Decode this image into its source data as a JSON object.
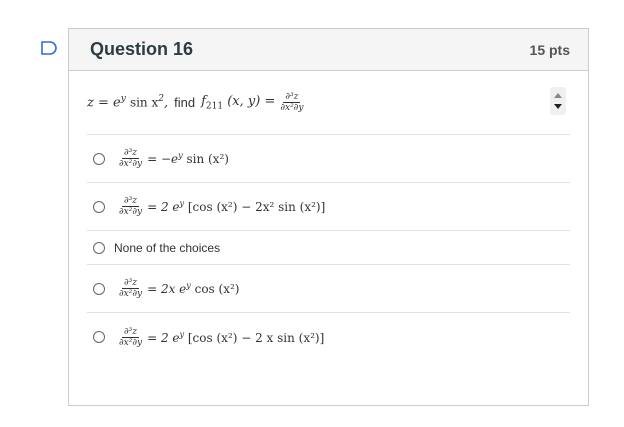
{
  "question": {
    "title": "Question 16",
    "points": "15 pts",
    "prompt_text": "find",
    "prompt_lhs": "z = e",
    "prompt_lhs_sup": "y",
    "prompt_sin": "sin x",
    "prompt_f": "f",
    "prompt_f_sub": "211",
    "prompt_args": "(x, y) =",
    "prompt_frac_num": "∂³z",
    "prompt_frac_den": "∂x²∂y"
  },
  "answers": [
    {
      "frac_num": "∂³z",
      "frac_den": "∂x²∂y",
      "rhs": "= −e",
      "rhs_sup": "y",
      "rhs_tail": " sin (x²)"
    },
    {
      "frac_num": "∂³z",
      "frac_den": "∂x²∂y",
      "rhs": "= 2 e",
      "rhs_sup": "y",
      "rhs_tail": " [cos (x²) − 2x² sin (x²)]"
    },
    {
      "text": "None of the choices"
    },
    {
      "frac_num": "∂³z",
      "frac_den": "∂x²∂y",
      "rhs": "= 2x e",
      "rhs_sup": "y",
      "rhs_tail": " cos (x²)"
    },
    {
      "frac_num": "∂³z",
      "frac_den": "∂x²∂y",
      "rhs": "= 2 e",
      "rhs_sup": "y",
      "rhs_tail": " [cos (x²) − 2 x sin (x²)]"
    }
  ]
}
